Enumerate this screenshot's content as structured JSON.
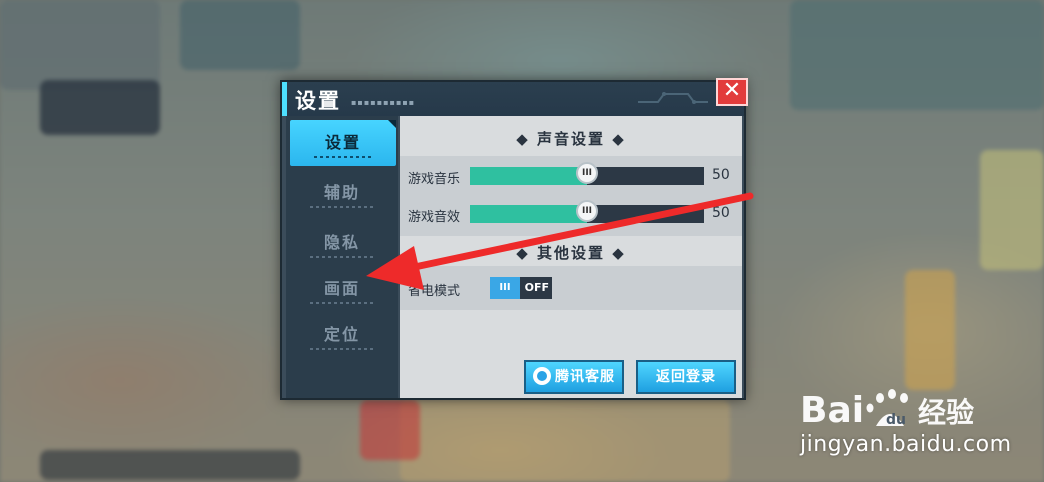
{
  "dialog": {
    "title": "设置",
    "close_symbol": "✕",
    "sidebar": {
      "items": [
        {
          "label": "设置",
          "active": true
        },
        {
          "label": "辅助",
          "active": false
        },
        {
          "label": "隐私",
          "active": false
        },
        {
          "label": "画面",
          "active": false
        },
        {
          "label": "定位",
          "active": false
        }
      ]
    },
    "sound_section": {
      "title": "◆ 声音设置 ◆",
      "rows": [
        {
          "label": "游戏音乐",
          "value": 50,
          "max": 100,
          "value_text": "50"
        },
        {
          "label": "游戏音效",
          "value": 50,
          "max": 100,
          "value_text": "50"
        }
      ]
    },
    "other_section": {
      "title": "◆ 其他设置 ◆",
      "power_save": {
        "label": "省电模式",
        "knob": "III",
        "state": "OFF"
      }
    },
    "buttons": {
      "support": "腾讯客服",
      "back": "返回登录"
    }
  },
  "colors": {
    "accent": "#3ec9ff",
    "slider_fill": "#2fc0a0",
    "close": "#e23b3b",
    "arrow": "#ee2a2a"
  },
  "watermark": {
    "logo_text_left": "Bai",
    "logo_text_right": "经验",
    "url": "jingyan.baidu.com"
  }
}
